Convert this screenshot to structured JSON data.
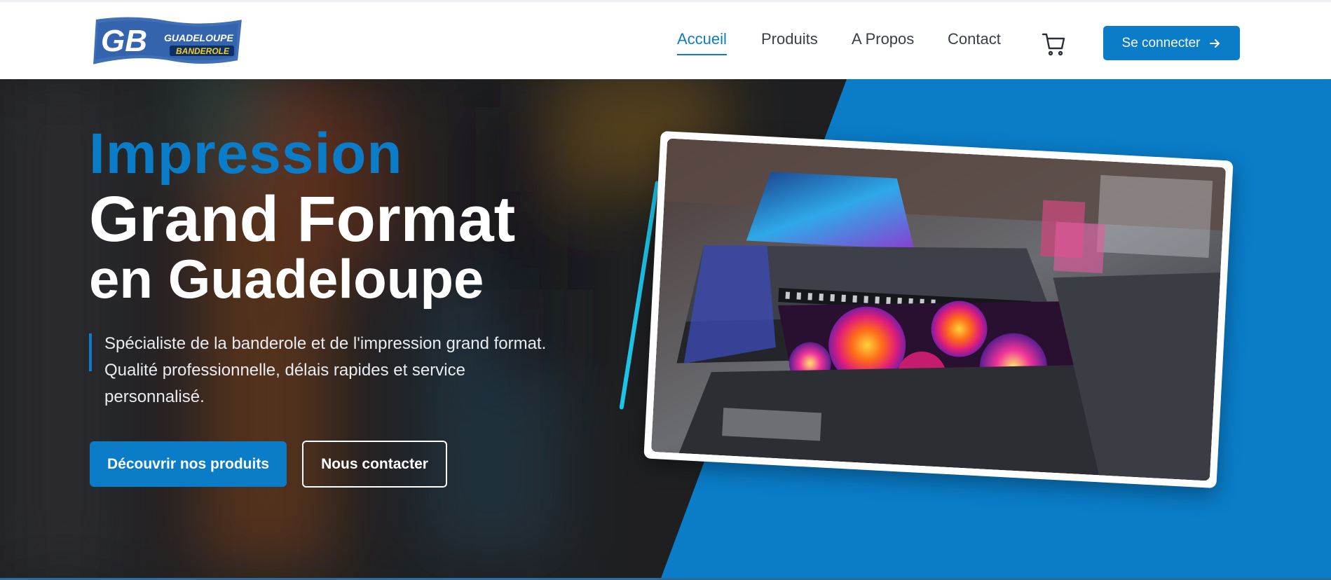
{
  "brand": {
    "logo_main": "GB",
    "logo_line1": "GUADELOUPE",
    "logo_line2": "BANDEROLE"
  },
  "nav": {
    "items": [
      {
        "label": "Accueil",
        "active": true
      },
      {
        "label": "Produits",
        "active": false
      },
      {
        "label": "A Propos",
        "active": false
      },
      {
        "label": "Contact",
        "active": false
      }
    ],
    "cart_icon": "cart-icon",
    "login_label": "Se connecter",
    "login_icon": "arrow-right-icon"
  },
  "hero": {
    "title_line1": "Impression",
    "title_line2": "Grand Format",
    "title_line3": "en Guadeloupe",
    "description_lines": [
      "Spécialiste de la banderole et de l'impression grand format.",
      "Qualité professionnelle, délais rapides et service",
      "personnalisé."
    ],
    "primary_button": "Découvrir nos produits",
    "secondary_button": "Nous contacter",
    "image_subject": "large-format-printer-photo"
  },
  "colors": {
    "accent": "#0a7cc8",
    "cyan_accent": "#1ec4e8",
    "dark_bg": "#1e1f22",
    "nav_text": "#3a3f47"
  }
}
